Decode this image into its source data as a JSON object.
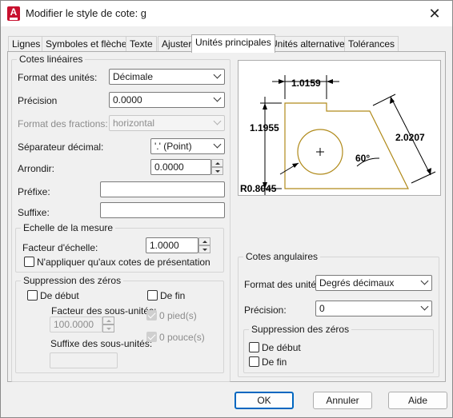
{
  "window": {
    "title": "Modifier le style de cote: g",
    "close_glyph": "✕",
    "app_icon_letter": "A"
  },
  "tabs": [
    {
      "label": "Lignes"
    },
    {
      "label": "Symboles et flèches"
    },
    {
      "label": "Texte"
    },
    {
      "label": "Ajuster"
    },
    {
      "label": "Unités principales"
    },
    {
      "label": "Unités alternatives"
    },
    {
      "label": "Tolérances"
    }
  ],
  "linear": {
    "group_title": "Cotes linéaires",
    "unit_format": {
      "label": "Format des unités:",
      "value": "Décimale"
    },
    "precision": {
      "label": "Précision",
      "value": "0.0000"
    },
    "fraction_format": {
      "label": "Format des fractions:",
      "value": "horizontal"
    },
    "decimal_separator": {
      "label": "Séparateur décimal:",
      "value": "'.' (Point)"
    },
    "round_off": {
      "label": "Arrondir:",
      "value": "0.0000"
    },
    "prefix": {
      "label": "Préfixe:",
      "value": ""
    },
    "suffix": {
      "label": "Suffixe:",
      "value": ""
    }
  },
  "scale": {
    "group_title": "Echelle de la mesure",
    "factor": {
      "label": "Facteur d'échelle:",
      "value": "1.0000"
    },
    "layout_only": {
      "label": "N'appliquer qu'aux cotes de présentation",
      "checked": false
    }
  },
  "zero_linear": {
    "group_title": "Suppression des zéros",
    "leading": {
      "label": "De début",
      "checked": false
    },
    "trailing": {
      "label": "De fin",
      "checked": false
    },
    "sub_units_factor": {
      "label": "Facteur des sous-unités:",
      "value": "100.0000"
    },
    "sub_units_suffix": {
      "label": "Suffixe des sous-unités:",
      "value": ""
    },
    "feet": {
      "label": "0 pied(s)",
      "checked": true
    },
    "inches": {
      "label": "0 pouce(s)",
      "checked": true
    }
  },
  "preview": {
    "dim_top": "1.0159",
    "dim_left": "1.1955",
    "dim_aligned": "2.0207",
    "dim_angle": "60°",
    "dim_radius": "R0.8045",
    "line_color": "#b08a1a"
  },
  "angular": {
    "group_title": "Cotes angulaires",
    "unit_format": {
      "label": "Format des unités:",
      "value": "Degrés décimaux"
    },
    "precision": {
      "label": "Précision:",
      "value": "0"
    },
    "zero_group_title": "Suppression des zéros",
    "leading": {
      "label": "De début",
      "checked": false
    },
    "trailing": {
      "label": "De fin",
      "checked": false
    }
  },
  "buttons": {
    "ok": "OK",
    "cancel": "Annuler",
    "help": "Aide"
  }
}
